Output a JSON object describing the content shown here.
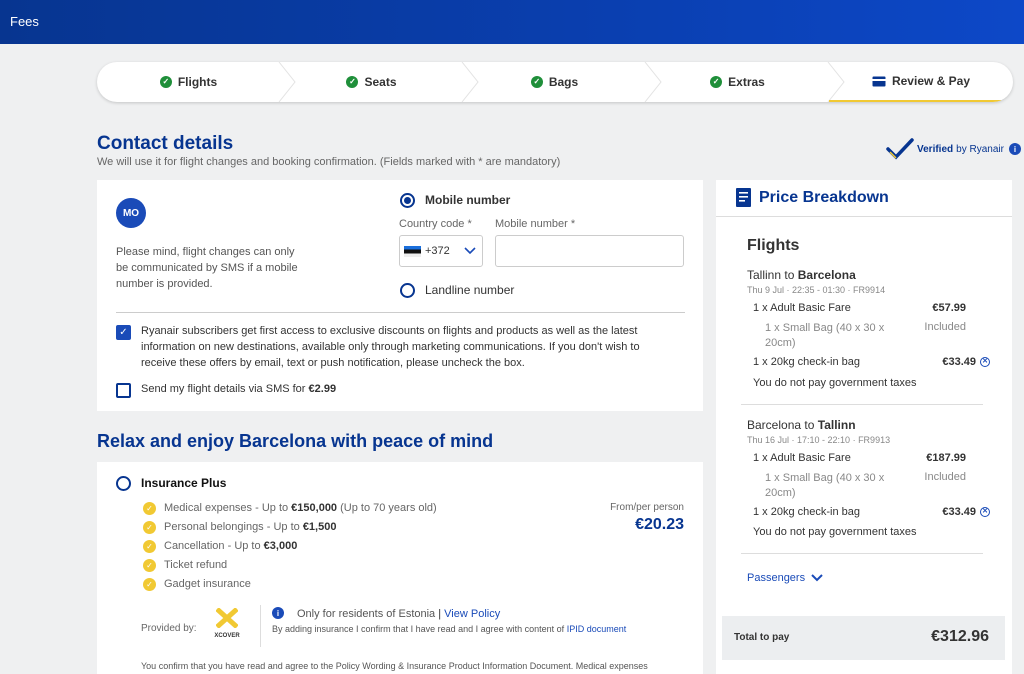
{
  "header": {
    "title": "Fees"
  },
  "steps": [
    {
      "label": "Flights"
    },
    {
      "label": "Seats"
    },
    {
      "label": "Bags"
    },
    {
      "label": "Extras"
    },
    {
      "label": "Review & Pay"
    }
  ],
  "contact": {
    "title": "Contact details",
    "subtitle": "We will use it for flight changes and booking confirmation. (Fields marked with * are mandatory)",
    "verified_bold": "Verified",
    "verified_rest": "by Ryanair",
    "avatar": "MO",
    "sms_note": "Please mind, flight changes can only be communicated by SMS if a mobile number is provided.",
    "mobile_label": "Mobile number",
    "country_code_label": "Country code *",
    "country_code_value": "+372",
    "mobile_number_label": "Mobile number *",
    "mobile_number_value": "",
    "landline_label": "Landline number",
    "subscribe_text": "Ryanair subscribers get first access to exclusive discounts on flights and products as well as the latest information on new destinations, available only through marketing communications. If you don't wish to receive these offers by email, text or push notification, please uncheck the box.",
    "sms_details_text": "Send my flight details via SMS for",
    "sms_details_price": "€2.99"
  },
  "insurance": {
    "section_title": "Relax and enjoy Barcelona with peace of mind",
    "plan_name": "Insurance Plus",
    "benefits": [
      {
        "text": "Medical expenses - Up to ",
        "bold": "€150,000",
        "tail": " (Up to 70 years old)"
      },
      {
        "text": "Personal belongings - Up to ",
        "bold": "€1,500",
        "tail": ""
      },
      {
        "text": "Cancellation - Up to ",
        "bold": "€3,000",
        "tail": ""
      },
      {
        "text": "Ticket refund",
        "bold": "",
        "tail": ""
      },
      {
        "text": "Gadget insurance",
        "bold": "",
        "tail": ""
      }
    ],
    "from_label": "From/per person",
    "price": "€20.23",
    "provided_by": "Provided by:",
    "provider": "XCOVER",
    "residents_note": "Only for residents of Estonia",
    "view_policy": "View Policy",
    "agree_text": "By adding insurance I confirm that I have read and I agree with content of",
    "ipid_link": "IPID document",
    "footer_text": "You confirm that you have read and agree to the Policy Wording & Insurance Product Information Document. Medical expenses"
  },
  "price_breakdown": {
    "title": "Price Breakdown",
    "flights_heading": "Flights",
    "legs": [
      {
        "from": "Tallinn",
        "to_word": "to",
        "to": "Barcelona",
        "details": "Thu 9 Jul  ·  22:35 - 01:30  ·  FR9914",
        "fare_label": "1 x Adult Basic Fare",
        "fare_price": "€57.99",
        "small_bag_label": "1 x Small Bag (40 x 30 x 20cm)",
        "small_bag_price": "Included",
        "checkin_label": "1 x 20kg check-in bag",
        "checkin_price": "€33.49",
        "tax_note": "You do not pay government taxes"
      },
      {
        "from": "Barcelona",
        "to_word": "to",
        "to": "Tallinn",
        "details": "Thu 16 Jul  ·  17:10 - 22:10  ·  FR9913",
        "fare_label": "1 x Adult Basic Fare",
        "fare_price": "€187.99",
        "small_bag_label": "1 x Small Bag (40 x 30 x 20cm)",
        "small_bag_price": "Included",
        "checkin_label": "1 x 20kg check-in bag",
        "checkin_price": "€33.49",
        "tax_note": "You do not pay government taxes"
      }
    ],
    "passengers_label": "Passengers",
    "total_label": "Total to pay",
    "total_value": "€312.96"
  },
  "colors": {
    "brand_blue": "#073590",
    "accent_yellow": "#f1c933",
    "check_green": "#1f8f3a"
  }
}
